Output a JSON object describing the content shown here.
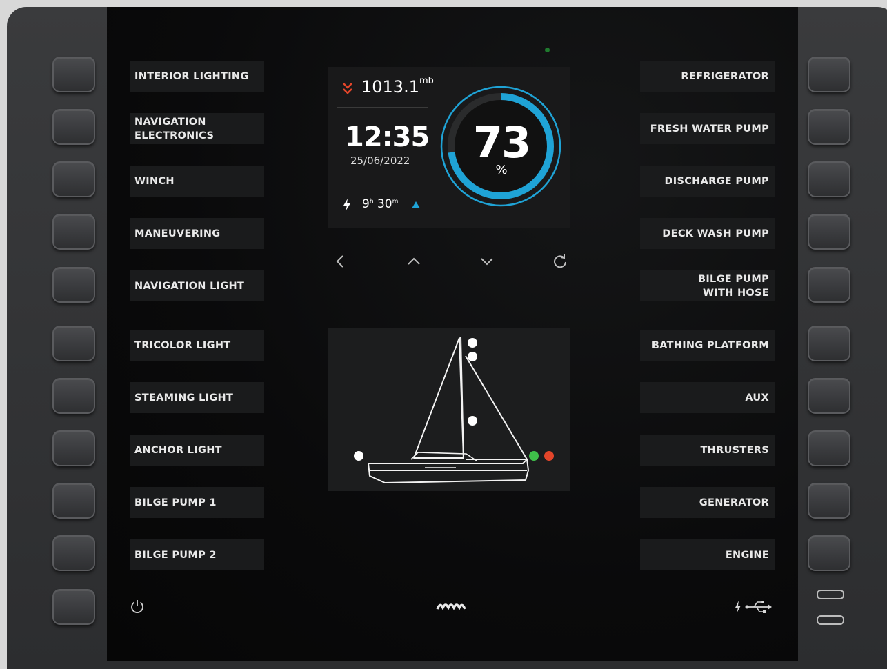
{
  "left_labels": [
    "INTERIOR LIGHTING",
    "NAVIGATION\nELECTRONICS",
    "WINCH",
    "MANEUVERING",
    "NAVIGATION LIGHT",
    "TRICOLOR LIGHT",
    "STEAMING LIGHT",
    "ANCHOR LIGHT",
    "BILGE PUMP 1",
    "BILGE PUMP 2"
  ],
  "right_labels": [
    "REFRIGERATOR",
    "FRESH WATER PUMP",
    "DISCHARGE PUMP",
    "DECK WASH PUMP",
    "BILGE PUMP\nWITH HOSE",
    "BATHING PLATFORM",
    "AUX",
    "THRUSTERS",
    "GENERATOR",
    "ENGINE"
  ],
  "display": {
    "pressure": {
      "value": "1013.1",
      "unit": "mb",
      "trend_icon": "double-chevron-down-icon"
    },
    "time": "12:35",
    "date": "25/06/2022",
    "runtime": {
      "hours": "9",
      "h_unit": "h",
      "minutes": "30",
      "m_unit": "m",
      "trend": "up"
    },
    "battery": {
      "value": "73",
      "unit": "%",
      "level": 0.73
    }
  },
  "nav_icons": [
    "chevron-left-icon",
    "chevron-up-icon",
    "chevron-down-icon",
    "refresh-icon"
  ],
  "colors": {
    "accent": "#1fa3d6",
    "alert": "#e2452a",
    "green_light": "#3fbf4a",
    "red_light": "#e2452a"
  },
  "footer_icons": [
    "power-icon",
    "waves-logo-icon",
    "usb-charging-icon"
  ]
}
